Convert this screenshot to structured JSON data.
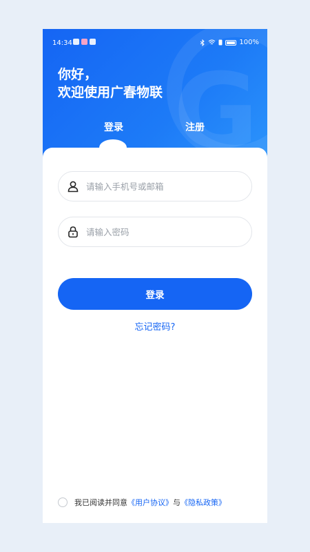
{
  "status_bar": {
    "time": "14:34",
    "battery": "100%"
  },
  "header": {
    "greeting_line1": "你好，",
    "greeting_line2": "欢迎使用广春物联"
  },
  "tabs": [
    {
      "label": "登录",
      "active": true
    },
    {
      "label": "注册",
      "active": false
    }
  ],
  "form": {
    "account_placeholder": "请输入手机号或邮箱",
    "account_icon": "user-icon",
    "password_placeholder": "请输入密码",
    "password_icon": "lock-icon",
    "login_label": "登录",
    "forgot_label": "忘记密码?"
  },
  "agreement": {
    "prefix": "我已阅读并同意",
    "user_agreement": "《用户协议》",
    "conjunction": "与",
    "privacy_policy": "《隐私政策》"
  },
  "colors": {
    "accent": "#1565f4",
    "background": "#e8eff8"
  }
}
